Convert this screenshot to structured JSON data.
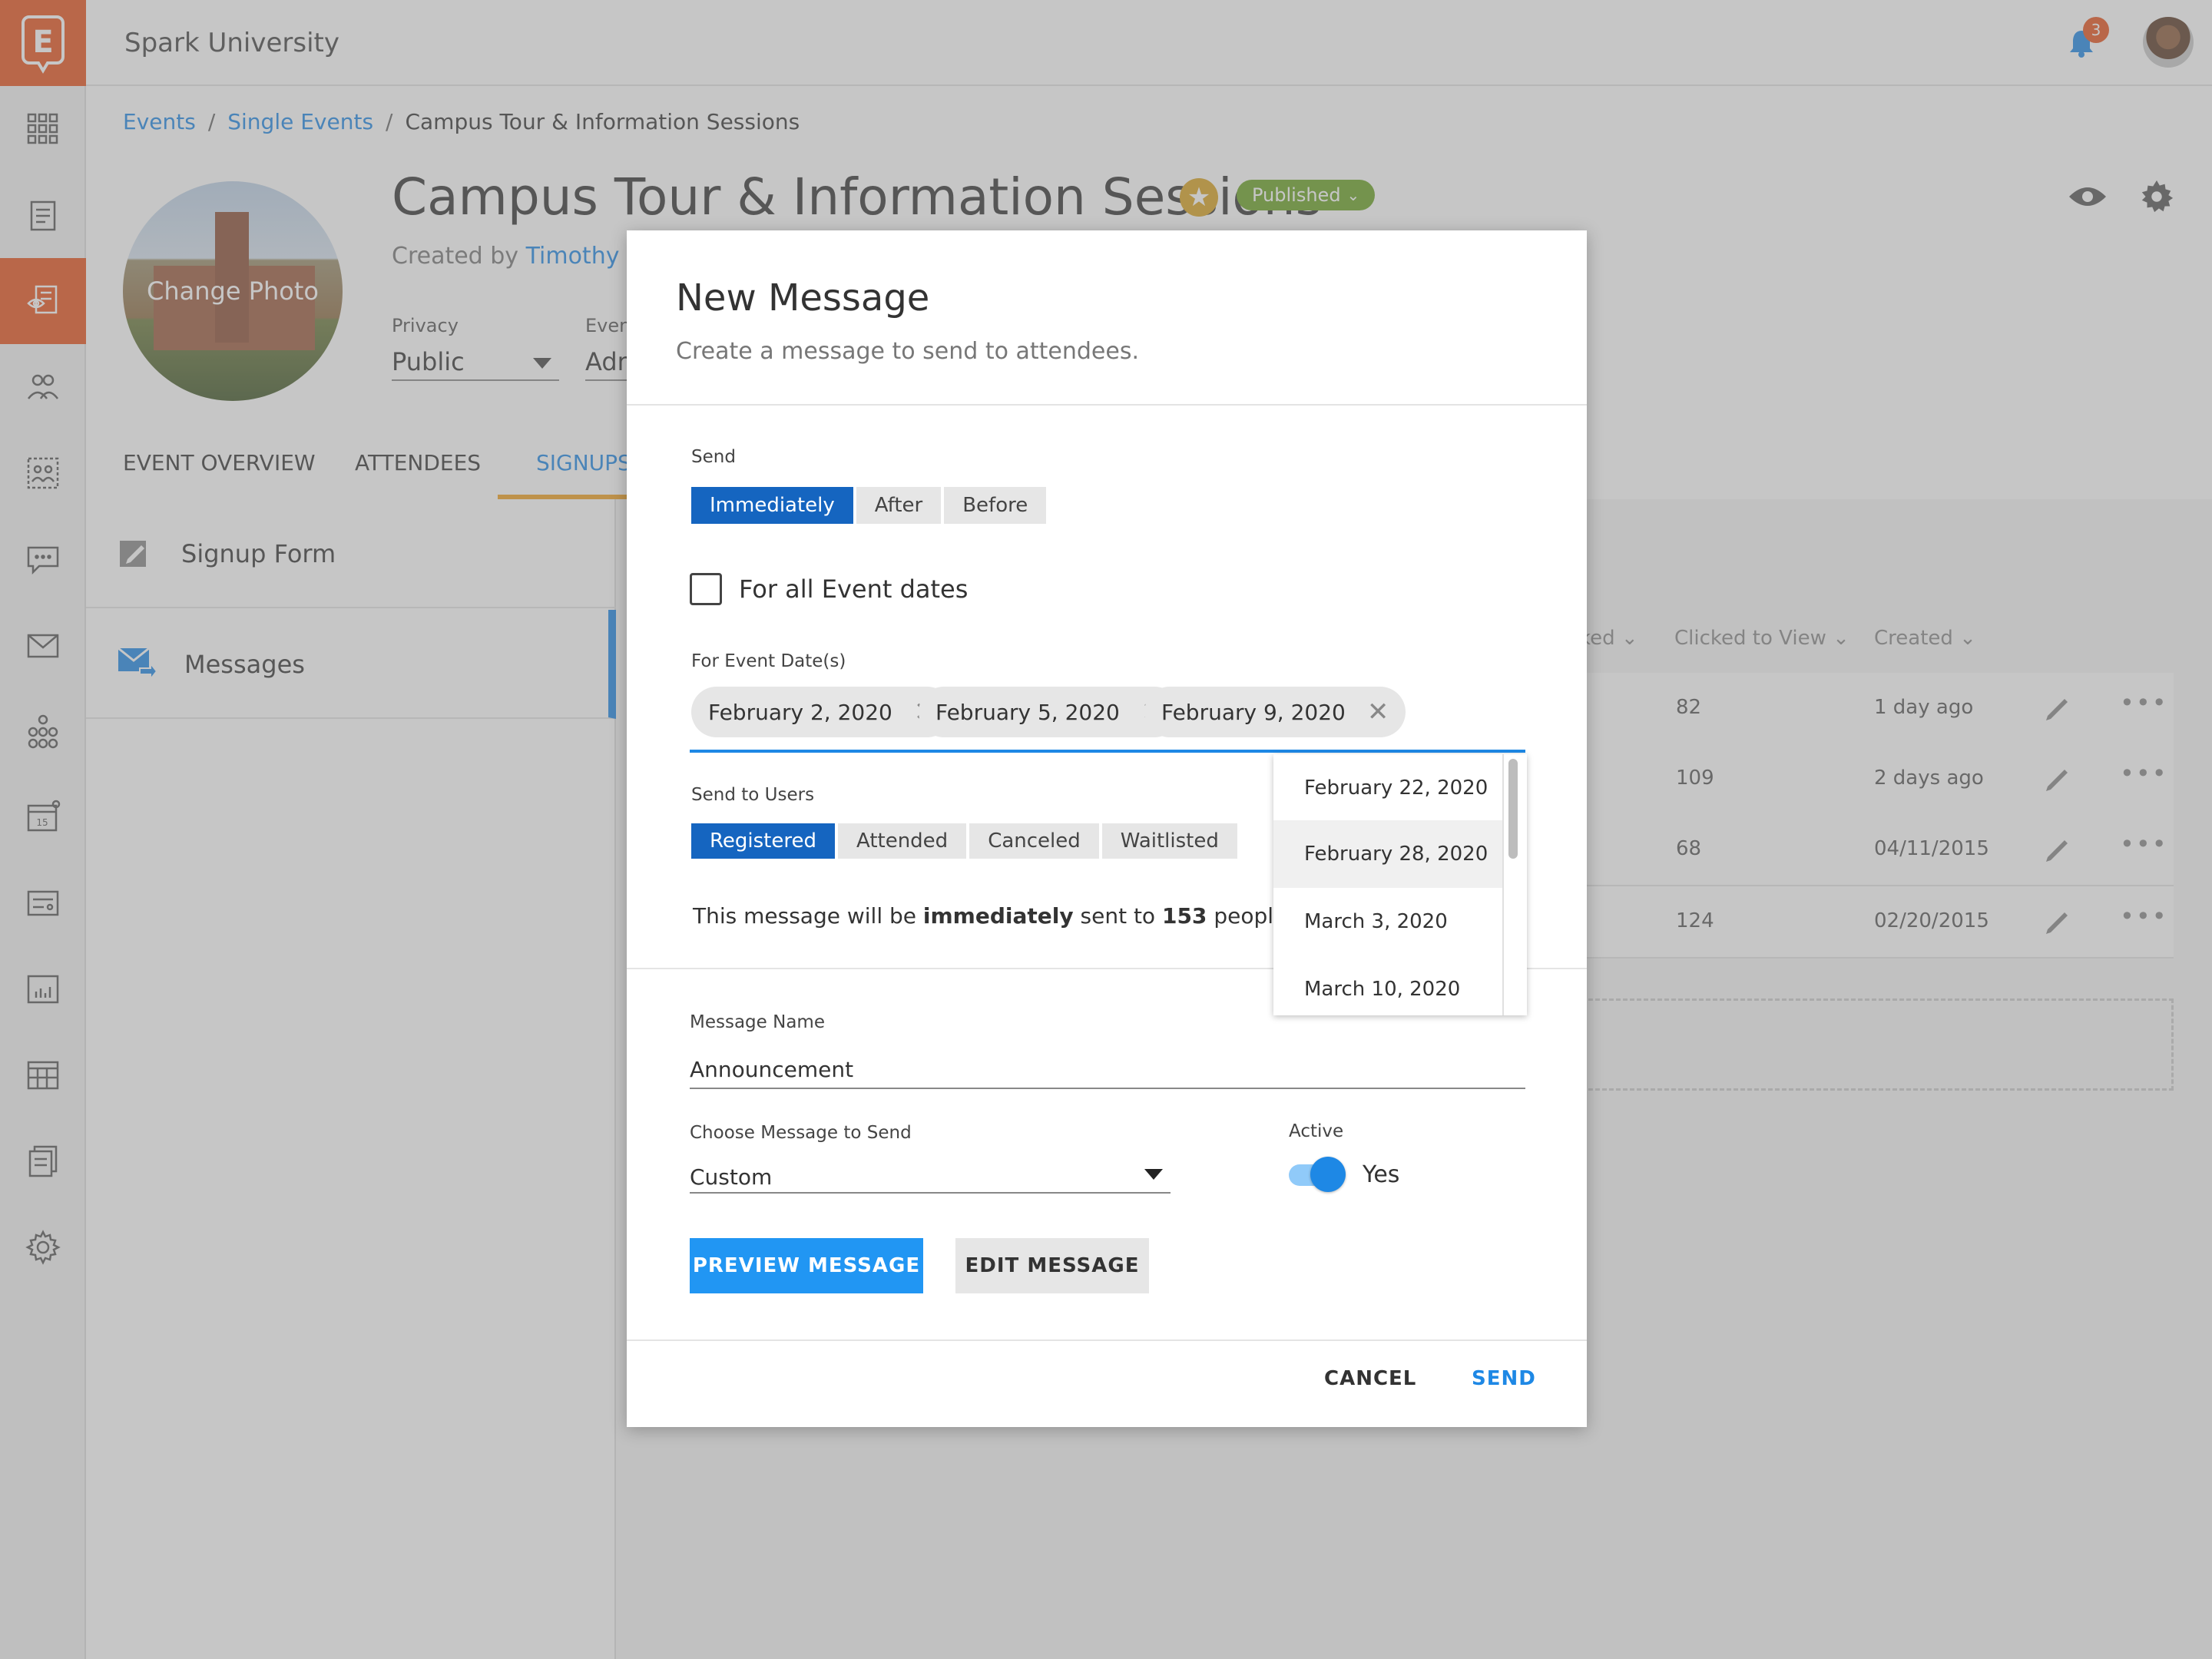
{
  "app": {
    "title": "Spark University",
    "notification_count": "3",
    "logo_letter": "E"
  },
  "sidebar": {
    "items": [
      "apps",
      "forms",
      "events",
      "people",
      "groups",
      "chat",
      "mail",
      "org-chart",
      "calendar",
      "billing",
      "reports",
      "schedule",
      "documents",
      "settings"
    ],
    "calendar_day": "15"
  },
  "breadcrumb": {
    "items": [
      "Events",
      "Single Events"
    ],
    "current": "Campus Tour & Information Sessions"
  },
  "event": {
    "title": "Campus Tour & Information Sessions",
    "status": "Published",
    "created_by_prefix": "Created by ",
    "created_by_name": "Timothy Cla",
    "photo_label": "Change Photo",
    "privacy_label": "Privacy",
    "privacy_value": "Public",
    "type_label": "Event",
    "type_value": "Adm"
  },
  "tabs": [
    "EVENT OVERVIEW",
    "ATTENDEES",
    "SIGNUPS"
  ],
  "left_panel": {
    "items": [
      "Signup Form",
      "Messages"
    ]
  },
  "table": {
    "headers": [
      "ked",
      "Clicked to View",
      "Created"
    ],
    "rows": [
      {
        "clicked": "82",
        "created": "1 day ago"
      },
      {
        "clicked": "109",
        "created": "2 days ago"
      },
      {
        "clicked": "68",
        "created": "04/11/2015"
      },
      {
        "clicked": "124",
        "created": "02/20/2015"
      }
    ]
  },
  "modal": {
    "title": "New Message",
    "subtitle": "Create a message to send to attendees.",
    "send_label": "Send",
    "send_options": [
      "Immediately",
      "After",
      "Before"
    ],
    "all_dates_label": "For all Event dates",
    "event_dates_label": "For Event Date(s)",
    "selected_dates": [
      "February 2, 2020",
      "February 5, 2020",
      "February 9, 2020"
    ],
    "date_options": [
      "February 22, 2020",
      "February 28, 2020",
      "March 3, 2020",
      "March 10, 2020"
    ],
    "send_to_label": "Send to Users",
    "user_options": [
      "Registered",
      "Attended",
      "Canceled",
      "Waitlisted"
    ],
    "summary": {
      "prefix": "This message will be ",
      "mode": "immediately",
      "mid": " sent to ",
      "count": "153",
      "suffix": " people."
    },
    "message_name_label": "Message Name",
    "message_name_value": "Announcement",
    "choose_label": "Choose Message to Send",
    "choose_value": "Custom",
    "active_label": "Active",
    "active_value": "Yes",
    "preview_button": "PREVIEW MESSAGE",
    "edit_button": "EDIT MESSAGE",
    "cancel_button": "CANCEL",
    "send_button": "SEND"
  },
  "colors": {
    "brand": "#e7531c",
    "accent": "#1e88e5",
    "selected": "#1565c0",
    "published": "#6aa324",
    "star": "#d9a21f"
  }
}
